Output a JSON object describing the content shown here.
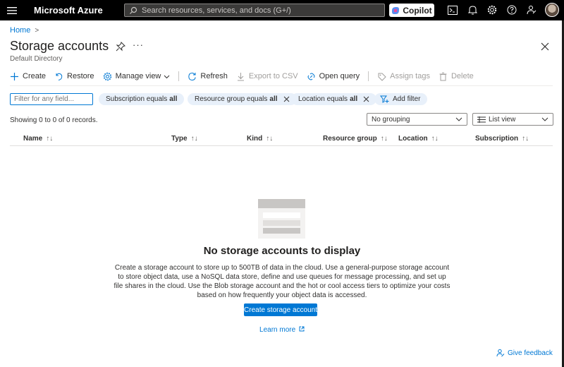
{
  "topbar": {
    "brand": "Microsoft Azure",
    "search_placeholder": "Search resources, services, and docs (G+/)",
    "copilot_label": "Copilot"
  },
  "breadcrumb": {
    "home": "Home"
  },
  "page": {
    "title": "Storage accounts",
    "subtitle": "Default Directory"
  },
  "toolbar": {
    "create": "Create",
    "restore": "Restore",
    "manage_view": "Manage view",
    "refresh": "Refresh",
    "export_csv": "Export to CSV",
    "open_query": "Open query",
    "assign_tags": "Assign tags",
    "delete": "Delete"
  },
  "filters": {
    "input_placeholder": "Filter for any field...",
    "subscription": {
      "label": "Subscription equals",
      "value": "all"
    },
    "resource_group": {
      "label": "Resource group equals",
      "value": "all"
    },
    "location": {
      "label": "Location equals",
      "value": "all"
    },
    "add_filter": "Add filter"
  },
  "records": {
    "showing": "Showing 0 to 0 of 0 records.",
    "grouping": "No grouping",
    "view": "List view"
  },
  "table": {
    "columns": [
      "Name",
      "Type",
      "Kind",
      "Resource group",
      "Location",
      "Subscription"
    ],
    "sort_name": "↑↓",
    "sort_other": "↑↓"
  },
  "empty": {
    "title": "No storage accounts to display",
    "description": "Create a storage account to store up to 500TB of data in the cloud. Use a general-purpose storage account to store object data, use a NoSQL data store, define and use queues for message processing, and set up file shares in the cloud. Use the Blob storage account and the hot or cool access tiers to optimize your costs based on how frequently your object data is accessed.",
    "cta": "Create storage account",
    "learn_more": "Learn more"
  },
  "feedback": "Give feedback",
  "colors": {
    "accent": "#0078d4",
    "topbar": "#000000",
    "pill": "#e8f0fa"
  }
}
